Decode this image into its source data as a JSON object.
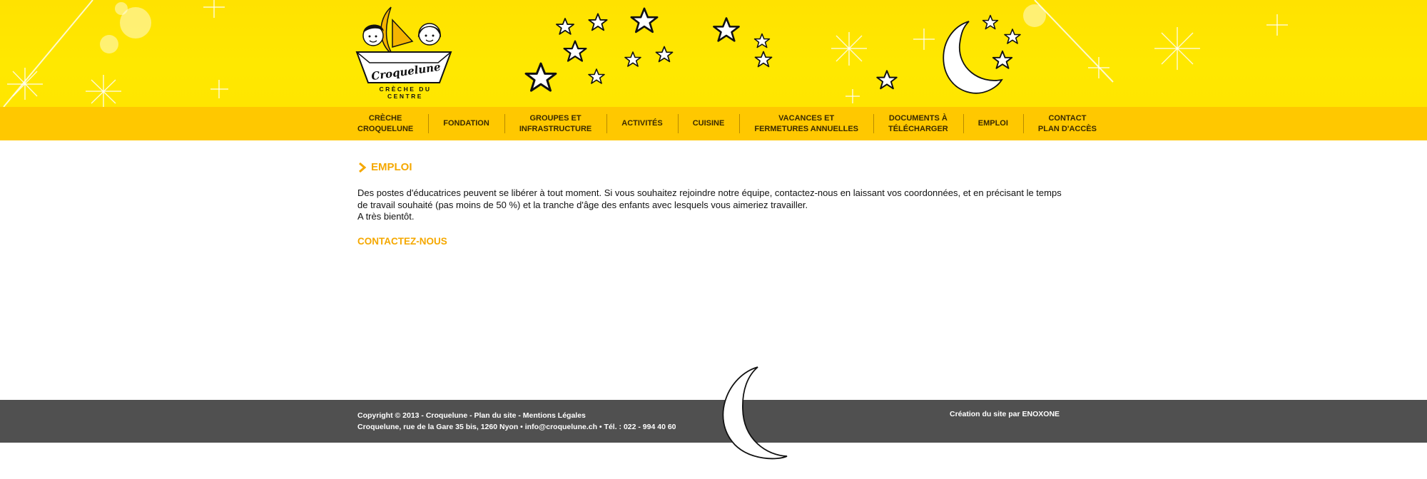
{
  "brand": {
    "name": "Croquelune",
    "tagline": "CRÈCHE DU CENTRE"
  },
  "nav": {
    "items": [
      {
        "label": "CRÈCHE\nCROQUELUNE"
      },
      {
        "label": "FONDATION"
      },
      {
        "label": "GROUPES ET\nINFRASTRUCTURE"
      },
      {
        "label": "ACTIVITÉS"
      },
      {
        "label": "CUISINE"
      },
      {
        "label": "VACANCES ET\nFERMETURES ANNUELLES"
      },
      {
        "label": "DOCUMENTS À\nTÉLÉCHARGER"
      },
      {
        "label": "EMPLOI"
      },
      {
        "label": "CONTACT\nPLAN  D'ACCÈS"
      }
    ]
  },
  "main": {
    "title": "EMPLOI",
    "paragraph1": "Des postes d'éducatrices peuvent se libérer à tout moment. Si vous souhaitez rejoindre notre équipe, contactez-nous en laissant vos coordonnées, et en précisant le temps de travail souhaité (pas moins de 50 %) et la tranche d'âge des enfants avec lesquels vous aimeriez travailler.",
    "paragraph2": "A très bientôt.",
    "contact_link": "CONTACTEZ-NOUS"
  },
  "footer": {
    "copyright": "Copyright © 2013 - Croquelune - ",
    "sitemap": "Plan du site",
    "sep": " - ",
    "legal": "Mentions Légales",
    "address": "Croquelune, rue de la Gare 35 bis, 1260 Nyon • ",
    "email": "info@croquelune.ch",
    "phone": " • Tél. : 022 - 994 40 60",
    "credit_prefix": "Création du site par ",
    "credit_agency": "ENOXONE"
  },
  "colors": {
    "header_yellow": "#ffe600",
    "nav_yellow": "#ffc800",
    "accent_orange": "#f5a800",
    "footer_gray": "#505050"
  }
}
